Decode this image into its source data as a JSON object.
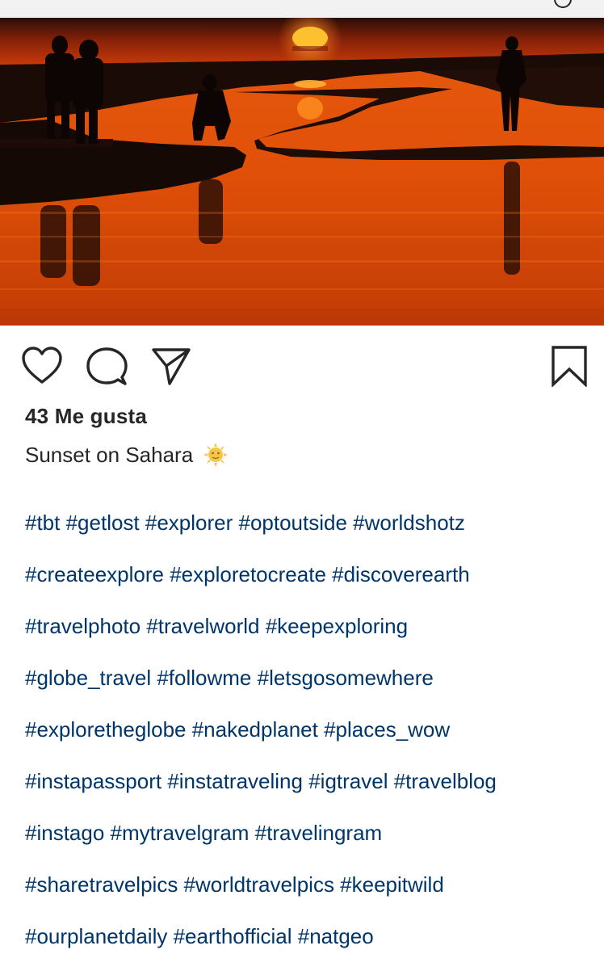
{
  "post": {
    "likes_label": "43 Me gusta",
    "caption": "Sunset on Sahara",
    "caption_emoji": "sun-face-emoji",
    "hashtag_lines": [
      "#tbt #getlost #explorer #optoutside #worldshotz",
      "#createexplore #exploretocreate #discoverearth",
      "#travelphoto #travelworld #keepexploring",
      "#globe_travel #followme  #letsgosomewhere",
      "#exploretheglobe #nakedplanet #places_wow",
      "#instapassport #instatraveling #igtravel #travelblog",
      "#instago #mytravelgram #travelingram",
      "#sharetravelpics #worldtravelpics  #keepitwild",
      "#ourplanetdaily #earthofficial #natgeo"
    ]
  },
  "icons": {
    "like": "heart-icon",
    "comment": "comment-bubble-icon",
    "share": "paper-plane-icon",
    "save": "bookmark-icon"
  },
  "colors": {
    "hashtag": "#003569",
    "text": "#262626",
    "sunset_orange": "#e0520c",
    "sky_dark": "#1a0e0a"
  }
}
